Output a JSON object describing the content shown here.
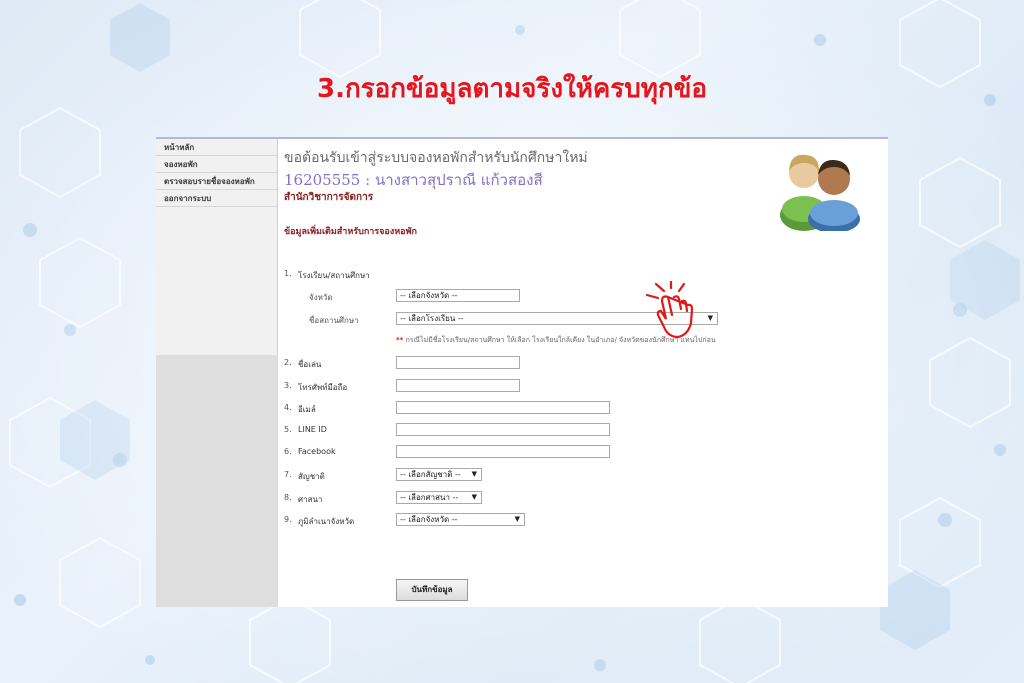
{
  "slide": {
    "title": "3.กรอกข้อมูลตามจริงให้ครบทุกข้อ",
    "title_color": "#e8141c"
  },
  "sidebar": {
    "items": [
      {
        "label": "หน้าหลัก"
      },
      {
        "label": "จองหอพัก"
      },
      {
        "label": "ตรวจสอบรายชื่อจองหอพัก"
      },
      {
        "label": "ออกจากระบบ"
      }
    ]
  },
  "header": {
    "welcome": "ขอต้อนรับเข้าสู่ระบบจองหอพักสำหรับนักศึกษาใหม่",
    "student": "16205555 : นางสาวสุปราณี แก้วสองสี",
    "office": "สำนักวิชาการจัดการ",
    "section_title": "ข้อมูลเพิ่มเติมสำหรับการจองหอพัก",
    "avatar_icon": "users-icon"
  },
  "form": {
    "school": {
      "num": "1.",
      "label": "โรงเรียน/สถานศึกษา",
      "province_label": "จังหวัด",
      "province_value": "-- เลือกจังหวัด --",
      "school_label": "ชื่อสถานศึกษา",
      "school_value": "-- เลือกโรงเรียน --",
      "note_stars": "**",
      "note": "กรณีไม่มีชื่อโรงเรียน/สถานศึกษา ให้เลือก โรงเรียนใกล้เคียง ในอำเภอ/ จังหวัดของนักศึกษา แทนไปก่อน"
    },
    "nickname": {
      "num": "2.",
      "label": "ชื่อเล่น",
      "value": ""
    },
    "mobile": {
      "num": "3.",
      "label": "โทรศัพท์มือถือ",
      "value": ""
    },
    "email": {
      "num": "4.",
      "label": "อีเมล์",
      "value": ""
    },
    "line": {
      "num": "5.",
      "label": "LINE ID",
      "value": ""
    },
    "facebook": {
      "num": "6.",
      "label": "Facebook",
      "value": ""
    },
    "nationality": {
      "num": "7.",
      "label": "สัญชาติ",
      "value": "-- เลือกสัญชาติ --"
    },
    "religion": {
      "num": "8.",
      "label": "ศาสนา",
      "value": "-- เลือกศาสนา --"
    },
    "hometown": {
      "num": "9.",
      "label": "ภูมิลำเนาจังหวัด",
      "value": "-- เลือกจังหวัด --"
    },
    "caret": "▼",
    "save_label": "บันทึกข้อมูล"
  },
  "cursor_icon": "hand-pointer-icon"
}
